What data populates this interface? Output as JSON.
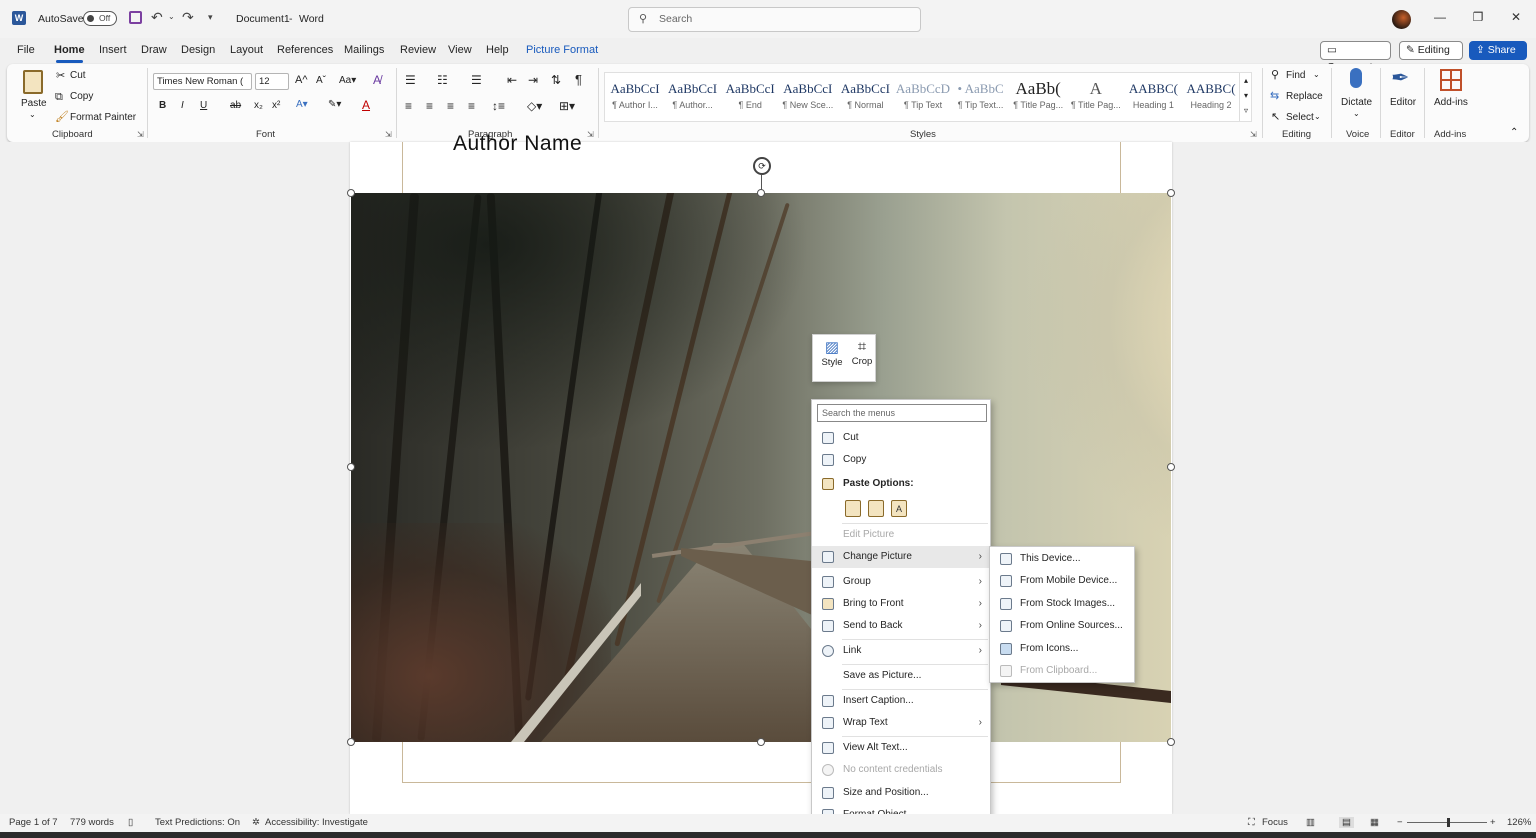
{
  "titlebar": {
    "autosave_label": "AutoSave",
    "autosave_state": "Off",
    "doc_title": "Document1",
    "separator": "-",
    "app_name": "Word",
    "search_placeholder": "Search"
  },
  "tabs": [
    "File",
    "Home",
    "Insert",
    "Draw",
    "Design",
    "Layout",
    "References",
    "Mailings",
    "Review",
    "View",
    "Help",
    "Picture Format"
  ],
  "active_tab": "Home",
  "top_buttons": {
    "comments": "Comments",
    "editing": "Editing",
    "share": "Share"
  },
  "ribbon": {
    "clipboard": {
      "paste": "Paste",
      "cut": "Cut",
      "copy": "Copy",
      "format_painter": "Format Painter",
      "label": "Clipboard"
    },
    "font": {
      "font_name": "Times New Roman (",
      "font_size": "12",
      "label": "Font",
      "bold": "B",
      "italic": "I",
      "underline": "U",
      "strike": "ab",
      "sub": "x₂",
      "sup": "x²"
    },
    "paragraph": {
      "label": "Paragraph"
    },
    "styles": {
      "label": "Styles",
      "tiles": [
        {
          "preview": "AaBbCcI",
          "name": "¶ Author I..."
        },
        {
          "preview": "AaBbCcI",
          "name": "¶ Author..."
        },
        {
          "preview": "AaBbCcI",
          "name": "¶ End"
        },
        {
          "preview": "AaBbCcI",
          "name": "¶ New Sce..."
        },
        {
          "preview": "AaBbCcI",
          "name": "¶ Normal"
        },
        {
          "preview": "AaBbCcD",
          "name": "¶ Tip Text"
        },
        {
          "preview": "• AaBbC",
          "name": "¶ Tip Text..."
        },
        {
          "preview": "AaBb(",
          "name": "¶ Title Pag..."
        },
        {
          "preview": "A",
          "name": "¶ Title Pag..."
        },
        {
          "preview": "AABBC(",
          "name": "Heading 1"
        },
        {
          "preview": "AABBC(",
          "name": "Heading 2"
        }
      ]
    },
    "editing": {
      "find": "Find",
      "replace": "Replace",
      "select": "Select",
      "label": "Editing"
    },
    "voice": {
      "dictate": "Dictate",
      "label": "Voice"
    },
    "editor": {
      "editor": "Editor",
      "label": "Editor"
    },
    "addins": {
      "addins": "Add-ins",
      "label": "Add-ins"
    }
  },
  "document": {
    "author_text": "Author Name"
  },
  "mini_toolbar": {
    "style": "Style",
    "crop": "Crop"
  },
  "context_menu": {
    "search_placeholder": "Search the menus",
    "items": [
      {
        "label": "Cut",
        "icon": "scissors-icon",
        "state": "normal"
      },
      {
        "label": "Copy",
        "icon": "copy-icon",
        "state": "normal"
      },
      {
        "label": "Paste Options:",
        "icon": "paste-icon",
        "state": "bold"
      },
      {
        "label": "Edit Picture",
        "icon": "",
        "state": "disabled"
      },
      {
        "label": "Change Picture",
        "icon": "change-picture-icon",
        "state": "highlight",
        "submenu": true
      },
      {
        "label": "Group",
        "icon": "group-icon",
        "state": "normal",
        "submenu": true
      },
      {
        "label": "Bring to Front",
        "icon": "bring-front-icon",
        "state": "normal",
        "submenu": true
      },
      {
        "label": "Send to Back",
        "icon": "send-back-icon",
        "state": "normal",
        "submenu": true
      },
      {
        "label": "Link",
        "icon": "link-icon",
        "state": "normal",
        "submenu": true
      },
      {
        "label": "Save as Picture...",
        "icon": "",
        "state": "normal"
      },
      {
        "label": "Insert Caption...",
        "icon": "caption-icon",
        "state": "normal"
      },
      {
        "label": "Wrap Text",
        "icon": "wrap-text-icon",
        "state": "normal",
        "submenu": true
      },
      {
        "label": "View Alt Text...",
        "icon": "alt-text-icon",
        "state": "normal"
      },
      {
        "label": "No content credentials",
        "icon": "info-icon",
        "state": "disabled"
      },
      {
        "label": "Size and Position...",
        "icon": "size-icon",
        "state": "normal"
      },
      {
        "label": "Format Object...",
        "icon": "format-icon",
        "state": "normal"
      }
    ]
  },
  "submenu": {
    "items": [
      {
        "label": "This Device...",
        "state": "normal"
      },
      {
        "label": "From Mobile Device...",
        "state": "normal"
      },
      {
        "label": "From Stock Images...",
        "state": "normal"
      },
      {
        "label": "From Online Sources...",
        "state": "normal"
      },
      {
        "label": "From Icons...",
        "state": "normal"
      },
      {
        "label": "From Clipboard...",
        "state": "disabled"
      }
    ]
  },
  "status": {
    "page": "Page 1 of 7",
    "words": "779 words",
    "predictions": "Text Predictions: On",
    "accessibility": "Accessibility: Investigate",
    "focus": "Focus",
    "zoom_minus": "−",
    "zoom_plus": "+",
    "zoom": "126%"
  },
  "colors": {
    "accent": "#185abd",
    "word_blue": "#2b579a"
  }
}
